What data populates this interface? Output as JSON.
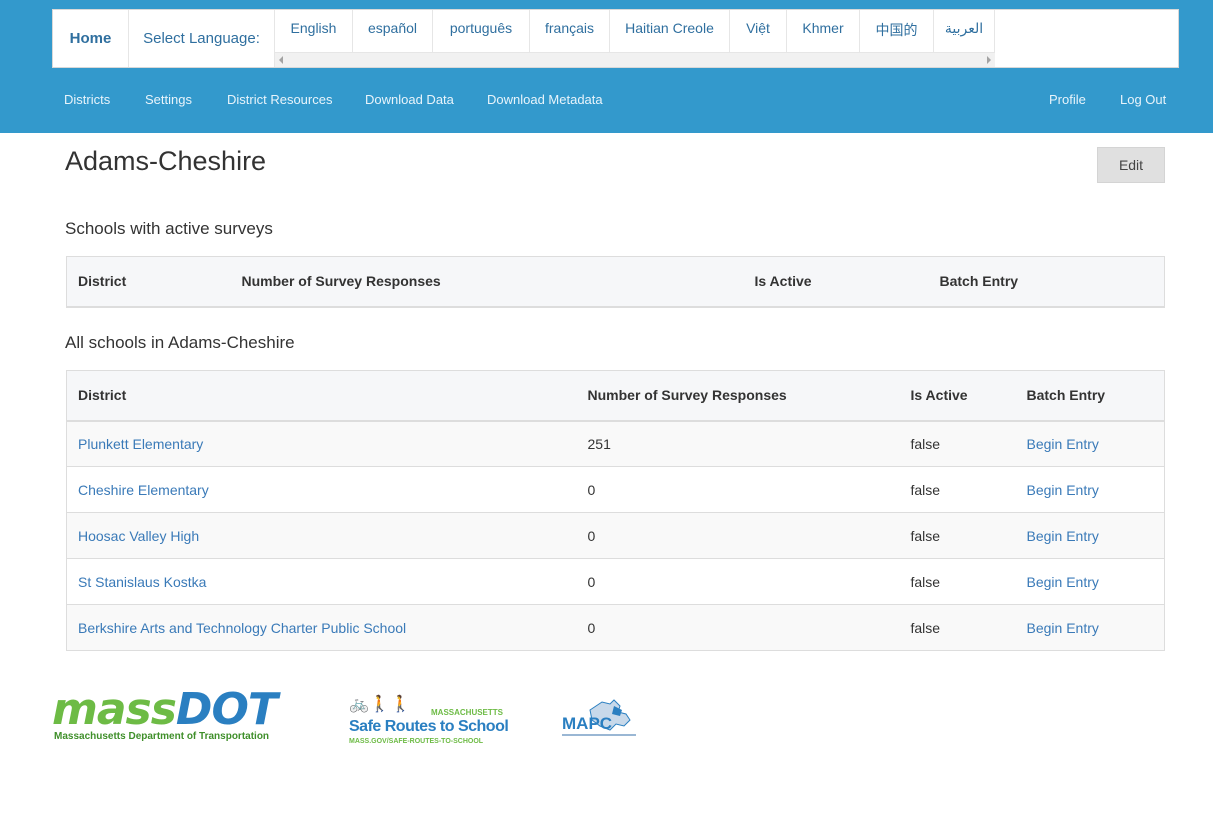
{
  "language_bar": {
    "home_label": "Home",
    "select_label": "Select Language:",
    "languages": [
      "English",
      "español",
      "português",
      "français",
      "Haitian Creole",
      "Việt",
      "Khmer",
      "中国的",
      "العربية"
    ]
  },
  "nav": {
    "left": [
      "Districts",
      "Settings",
      "District Resources",
      "Download Data",
      "Download Metadata"
    ],
    "right": [
      "Profile",
      "Log Out"
    ]
  },
  "page": {
    "title": "Adams-Cheshire",
    "edit_label": "Edit"
  },
  "active_section": {
    "title": "Schools with active surveys",
    "columns": [
      "District",
      "Number of Survey Responses",
      "Is Active",
      "Batch Entry"
    ]
  },
  "all_section": {
    "title": "All schools in Adams-Cheshire",
    "columns": [
      "District",
      "Number of Survey Responses",
      "Is Active",
      "Batch Entry"
    ],
    "rows": [
      {
        "district": "Plunkett Elementary",
        "responses": "251",
        "active": "false",
        "batch": "Begin Entry"
      },
      {
        "district": "Cheshire Elementary",
        "responses": "0",
        "active": "false",
        "batch": "Begin Entry"
      },
      {
        "district": "Hoosac Valley High",
        "responses": "0",
        "active": "false",
        "batch": "Begin Entry"
      },
      {
        "district": "St Stanislaus Kostka",
        "responses": "0",
        "active": "false",
        "batch": "Begin Entry"
      },
      {
        "district": "Berkshire Arts and Technology Charter Public School",
        "responses": "0",
        "active": "false",
        "batch": "Begin Entry"
      }
    ]
  },
  "footer": {
    "massdot": {
      "word_a": "mass",
      "word_b": "DOT",
      "subtitle": "Massachusetts Department of Transportation"
    },
    "srts": {
      "top": "MASSACHUSETTS",
      "main": "Safe Routes to School",
      "url": "MASS.GOV/SAFE-ROUTES-TO-SCHOOL"
    },
    "mapc": {
      "word": "MAPC"
    }
  },
  "colors": {
    "header_blue": "#3399cc",
    "link_blue": "#3a7ab8",
    "massdot_green": "#6dbb45",
    "massdot_blue": "#2a7fc1"
  }
}
